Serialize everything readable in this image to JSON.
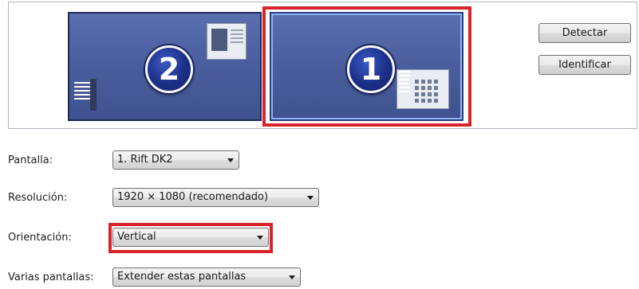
{
  "arrangement": {
    "monitors": [
      {
        "number": "2"
      },
      {
        "number": "1"
      }
    ],
    "buttons": {
      "detect": "Detectar",
      "identify": "Identificar"
    }
  },
  "settings": {
    "display": {
      "label": "Pantalla:",
      "value": "1. Rift DK2"
    },
    "resolution": {
      "label": "Resolución:",
      "value": "1920 × 1080 (recomendado)"
    },
    "orientation": {
      "label": "Orientación:",
      "value": "Vertical"
    },
    "multiple": {
      "label": "Varias pantallas:",
      "value": "Extender estas pantallas"
    }
  },
  "colors": {
    "monitor_fill": "#4b5f9f",
    "badge_fill": "#1b2f86",
    "highlight_red": "#d8232a"
  }
}
